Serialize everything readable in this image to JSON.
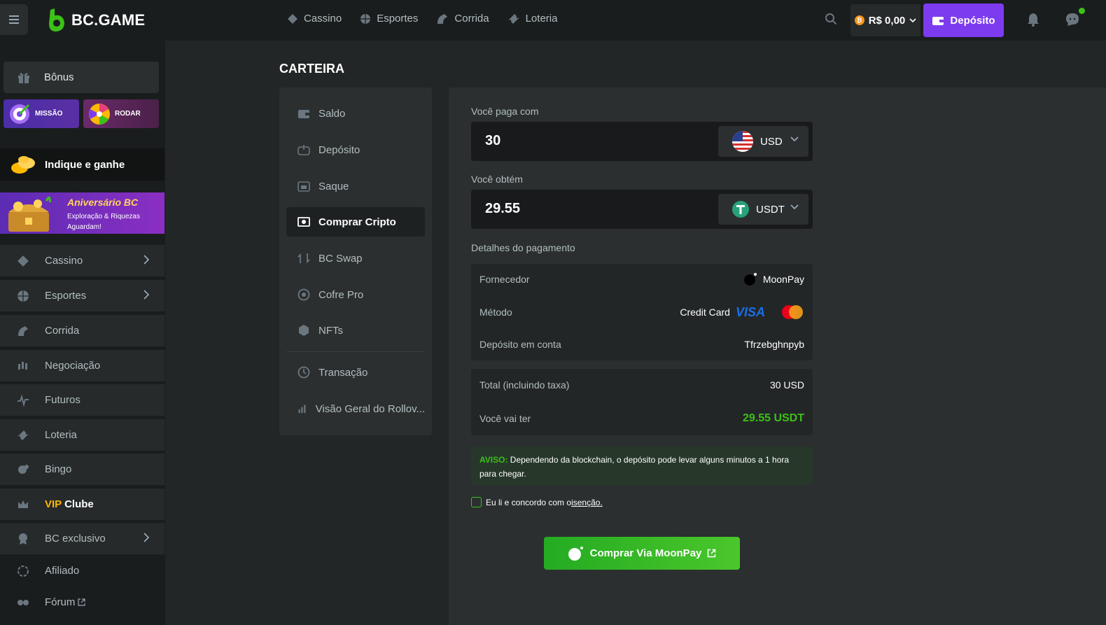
{
  "header": {
    "logo_text": "BC.GAME",
    "nav": [
      {
        "label": "Cassino",
        "icon": "diamond-icon"
      },
      {
        "label": "Esportes",
        "icon": "ball-icon"
      },
      {
        "label": "Corrida",
        "icon": "horse-icon"
      },
      {
        "label": "Loteria",
        "icon": "ticket-icon"
      }
    ],
    "balance": "R$ 0,00",
    "deposit_label": "Depósito"
  },
  "sidebar": {
    "bonus_label": "Bônus",
    "mission_label": "MISSÃO",
    "spin_label": "RODAR",
    "refer_label": "Indique e ganhe",
    "anniversary_title": "Aniversário BC",
    "anniversary_subtitle": "Exploração & Riquezas Aguardam!",
    "items": [
      {
        "label": "Cassino",
        "icon": "diamond-icon",
        "chevron": true
      },
      {
        "label": "Esportes",
        "icon": "ball-icon",
        "chevron": true
      },
      {
        "label": "Corrida",
        "icon": "horse-icon",
        "chevron": false
      },
      {
        "label": "Negociação",
        "icon": "candles-icon",
        "chevron": false
      },
      {
        "label": "Futuros",
        "icon": "pulse-icon",
        "chevron": false
      },
      {
        "label": "Loteria",
        "icon": "ticket-icon",
        "chevron": false
      },
      {
        "label": "Bingo",
        "icon": "bingo-icon",
        "chevron": false
      }
    ],
    "vip_prefix": "VIP",
    "vip_suffix": " Clube",
    "exclusive_label": "BC exclusivo",
    "affiliate_label": "Afiliado",
    "forum_label": "Fórum"
  },
  "wallet": {
    "title": "CARTEIRA",
    "nav": [
      {
        "label": "Saldo",
        "icon": "wallet-icon"
      },
      {
        "label": "Depósito",
        "icon": "deposit-icon"
      },
      {
        "label": "Saque",
        "icon": "withdraw-icon"
      },
      {
        "label": "Comprar Cripto",
        "icon": "buy-crypto-icon",
        "active": true
      },
      {
        "label": "BC Swap",
        "icon": "swap-icon"
      },
      {
        "label": "Cofre Pro",
        "icon": "vault-icon"
      },
      {
        "label": "NFTs",
        "icon": "nft-icon"
      },
      {
        "label": "Transação",
        "icon": "transaction-icon"
      },
      {
        "label": "Visão Geral do Rollov...",
        "icon": "chart-icon"
      }
    ]
  },
  "buy": {
    "pay_label": "Você paga com",
    "pay_amount": "30",
    "pay_currency": "USD",
    "get_label": "Você obtém",
    "get_amount": "29.55",
    "get_currency": "USDT",
    "details_label": "Detalhes do pagamento",
    "provider_key": "Fornecedor",
    "provider_val": "MoonPay",
    "method_key": "Método",
    "method_val": "Credit Card",
    "visa_text": "VISA",
    "account_key": "Depósito em conta",
    "account_val": "Tfrzebghnpyb",
    "total_key": "Total (incluindo taxa)",
    "total_val": "30 USD",
    "receive_key": "Você vai ter",
    "receive_val": "29.55 USDT",
    "notice_prefix": "AVISO:",
    "notice_text": " Dependendo da blockchain, o depósito pode levar alguns minutos a 1 hora para chegar.",
    "agree_text": "Eu li e concordo com o",
    "agree_link": " isenção.",
    "button_label": "Comprar Via MoonPay"
  },
  "colors": {
    "accent_purple": "#7d3bf0",
    "accent_green": "#3bc117",
    "bg": "#232626"
  }
}
